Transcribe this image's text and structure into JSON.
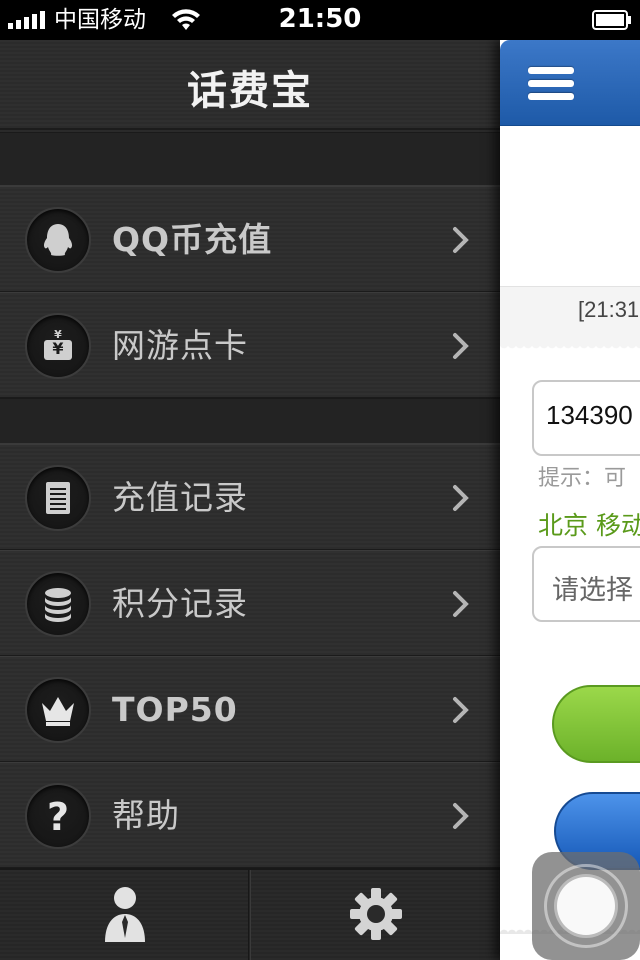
{
  "status_bar": {
    "carrier": "中国移动",
    "time": "21:50",
    "icons": [
      "signal-icon",
      "wifi-icon",
      "battery-icon"
    ]
  },
  "menu": {
    "title": "话费宝",
    "items": [
      {
        "label": "QQ币充值",
        "icon": "qq-penguin-icon"
      },
      {
        "label": "网游点卡",
        "icon": "game-card-icon"
      },
      {
        "label": "充值记录",
        "icon": "notepad-icon"
      },
      {
        "label": "积分记录",
        "icon": "coin-stack-icon"
      },
      {
        "label": "TOP50",
        "icon": "crown-icon"
      },
      {
        "label": "帮助",
        "icon": "question-icon"
      }
    ],
    "footer": {
      "left_icon": "user-icon",
      "right_icon": "gear-icon"
    }
  },
  "main": {
    "message_time": "[21:31",
    "phone_value": "134390",
    "hint": "提示：可",
    "location": "北京 移动",
    "amount_placeholder": "请选择"
  },
  "colors": {
    "navbar_blue": "#2a66b8",
    "location_green": "#5a9a1a",
    "menu_bg": "#2c2c2c",
    "menu_text": "#c9c9c9"
  }
}
